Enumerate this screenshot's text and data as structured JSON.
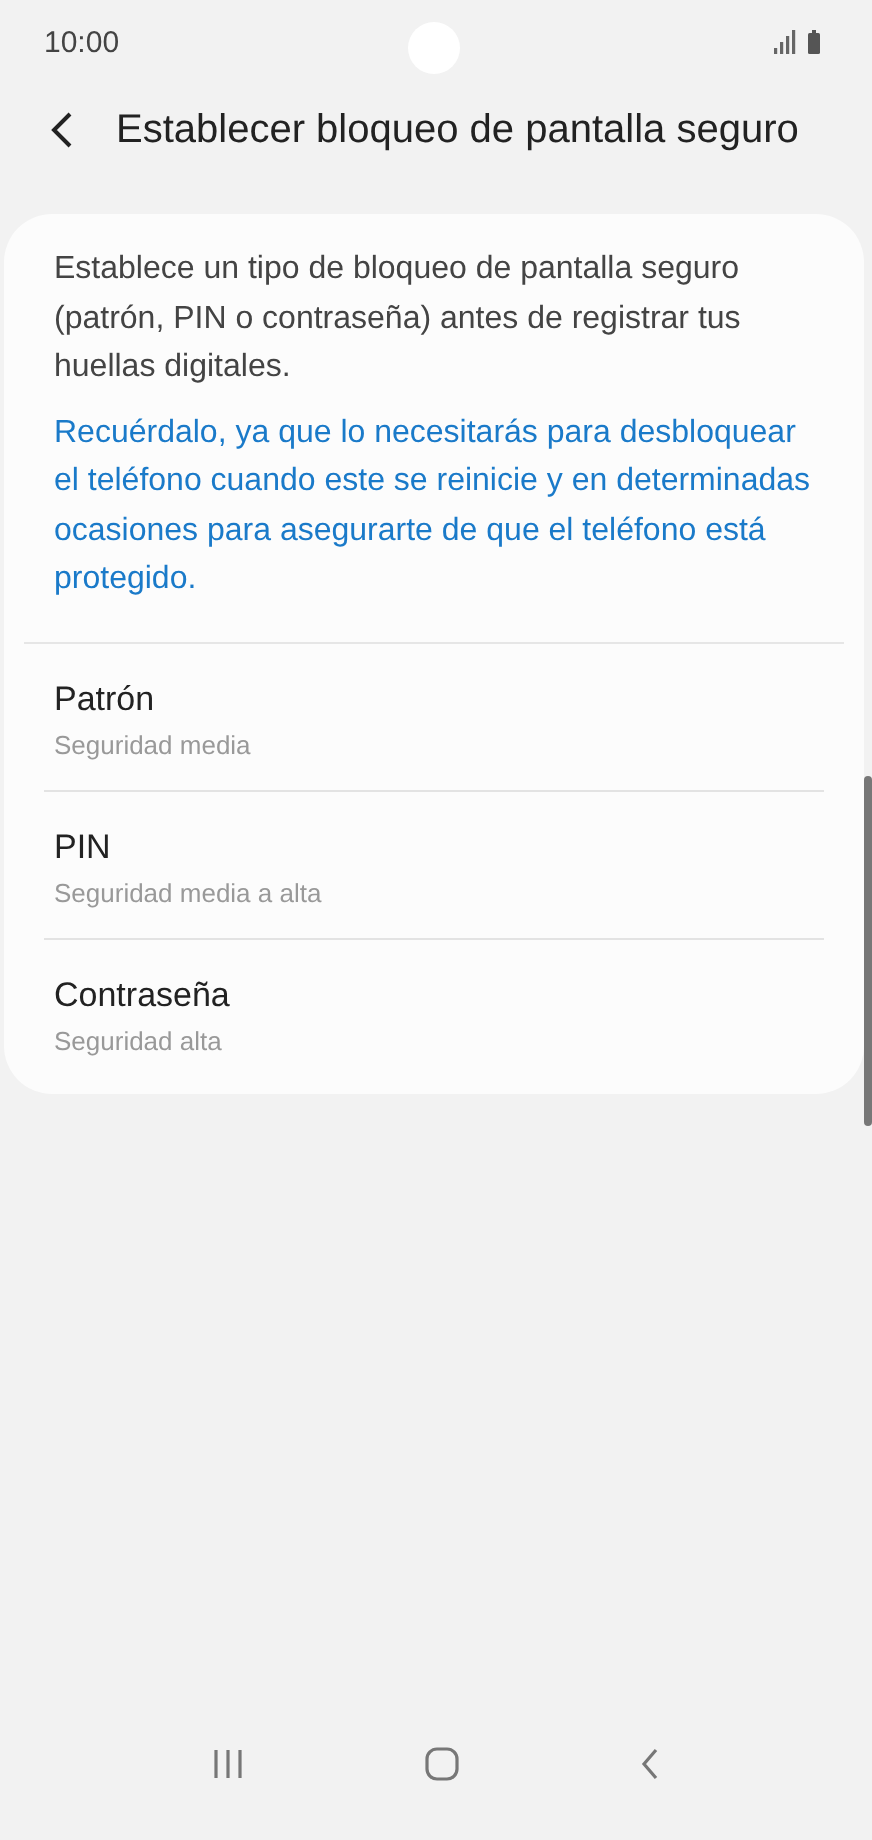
{
  "status_bar": {
    "time": "10:00"
  },
  "header": {
    "title": "Establecer bloqueo de pantalla seguro"
  },
  "card": {
    "description": "Establece un tipo de bloqueo de pantalla seguro (patrón, PIN o contraseña) antes de registrar tus huellas digitales.",
    "note": "Recuérdalo, ya que lo necesitarás para desbloquear el teléfono cuando este se reinicie y en determinadas ocasiones para asegurarte de que el teléfono está protegido.",
    "options": [
      {
        "title": "Patrón",
        "subtitle": "Seguridad media"
      },
      {
        "title": "PIN",
        "subtitle": "Seguridad media a alta"
      },
      {
        "title": "Contraseña",
        "subtitle": "Seguridad alta"
      }
    ]
  }
}
